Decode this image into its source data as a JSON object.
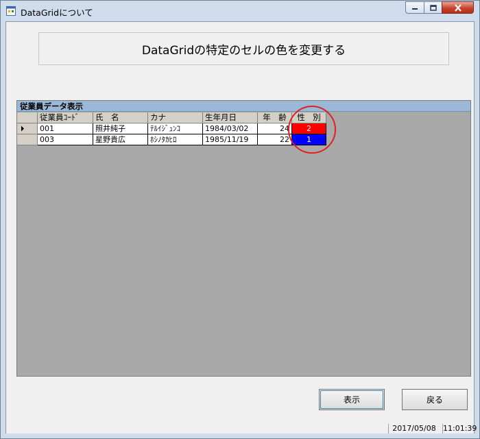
{
  "window": {
    "title": "DataGridについて"
  },
  "header": {
    "title": "DataGridの特定のセルの色を変更する"
  },
  "grid": {
    "caption": "従業員データ表示",
    "columns": [
      "従業員ｺｰﾄﾞ",
      "氏　名",
      "カナ",
      "生年月日",
      "年　齢",
      "性　別"
    ],
    "rows": [
      {
        "code": "001",
        "name": "照井純子",
        "kana": "ﾃﾙｲｼﾞｭﾝｺ",
        "birth": "1984/03/02",
        "age": "24",
        "gender": "2",
        "gender_color": "#ff0000"
      },
      {
        "code": "003",
        "name": "星野貴広",
        "kana": "ﾎｼﾉﾀｶﾋﾛ",
        "birth": "1985/11/19",
        "age": "22",
        "gender": "1",
        "gender_color": "#0000ff"
      }
    ],
    "background": "#a9a9a9",
    "caption_color": "#9bb8d6"
  },
  "buttons": {
    "show": "表示",
    "back": "戻る"
  },
  "status": {
    "date": "2017/05/08",
    "time": "11:01:39"
  },
  "icons": {
    "app": "app-icon",
    "minimize": "minimize-icon",
    "maximize": "maximize-icon",
    "close": "close-icon",
    "current_row": "row-pointer-icon"
  }
}
